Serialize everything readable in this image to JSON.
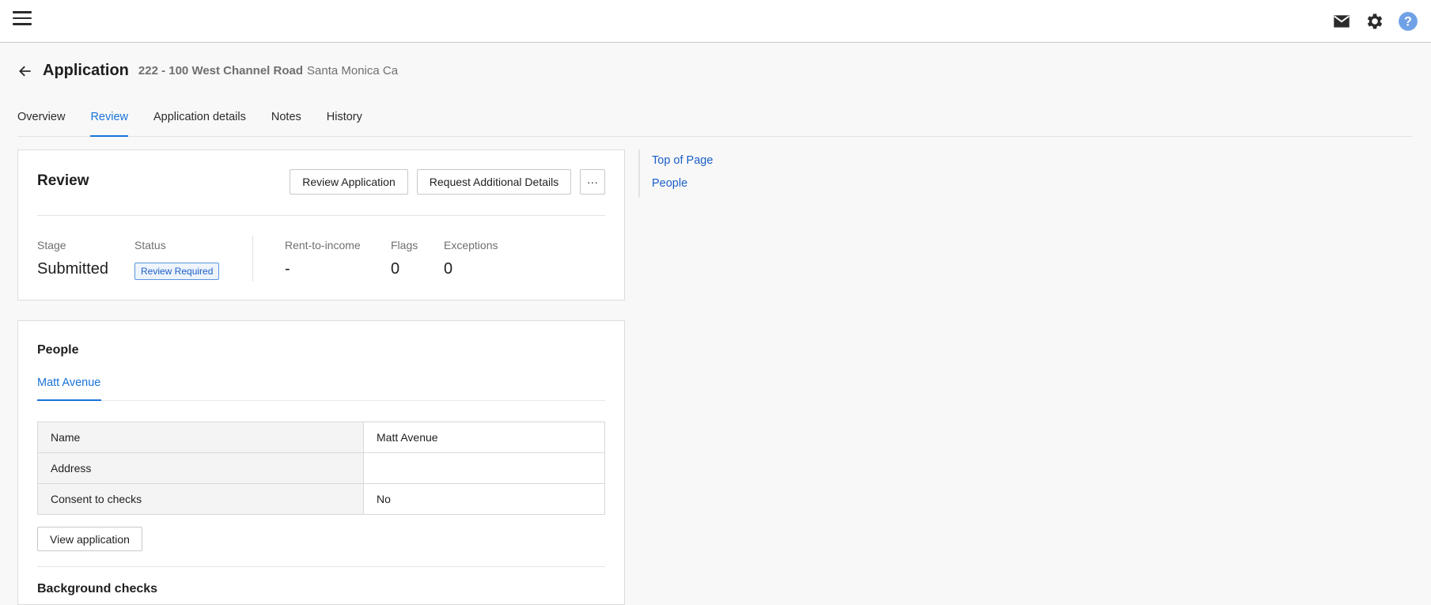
{
  "topbar": {
    "icons": [
      "menu-icon",
      "mail-icon",
      "gear-icon",
      "help-icon"
    ]
  },
  "header": {
    "title": "Application",
    "address_strong": "222 - 100 West Channel Road",
    "address_rest": "Santa Monica Ca"
  },
  "tabs": [
    "Overview",
    "Review",
    "Application details",
    "Notes",
    "History"
  ],
  "active_tab": "Review",
  "review": {
    "title": "Review",
    "review_button": "Review Application",
    "request_button": "Request Additional Details",
    "more_button": "···",
    "stage_label": "Stage",
    "stage_value": "Submitted",
    "status_label": "Status",
    "status_value": "Review Required",
    "rti_label": "Rent-to-income",
    "rti_value": "-",
    "flags_label": "Flags",
    "flags_value": "0",
    "exceptions_label": "Exceptions",
    "exceptions_value": "0"
  },
  "people": {
    "title": "People",
    "person_tab": "Matt Avenue",
    "rows": [
      {
        "key": "Name",
        "value": "Matt Avenue"
      },
      {
        "key": "Address",
        "value": ""
      },
      {
        "key": "Consent to checks",
        "value": "No"
      }
    ],
    "view_button": "View application",
    "next_section": "Background checks"
  },
  "side_nav": [
    "Top of Page",
    "People"
  ],
  "colors": {
    "accent": "#1a73d9",
    "link": "#1a5fc7",
    "badge_border": "#5a95e0",
    "help_icon": "#6fa1e6"
  }
}
